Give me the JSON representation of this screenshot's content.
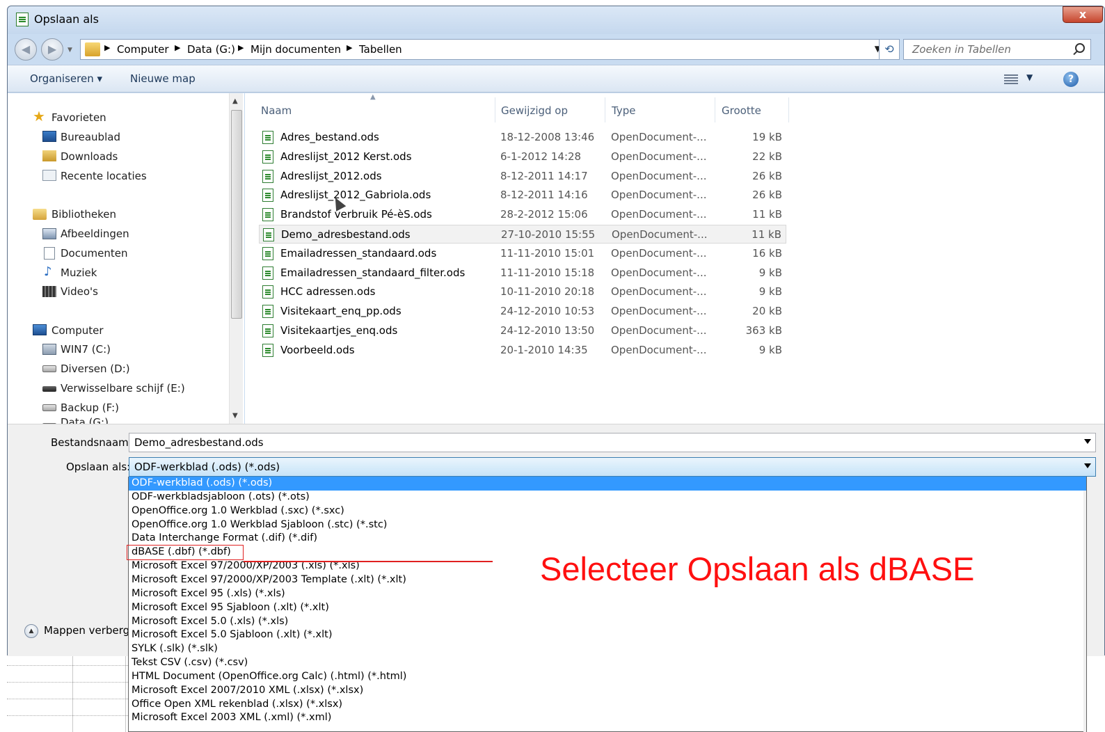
{
  "window": {
    "title": "Opslaan als",
    "close_label": "x"
  },
  "address": {
    "breadcrumbs": [
      "Computer",
      "Data (G:)",
      "Mijn documenten",
      "Tabellen"
    ],
    "search_placeholder": "Zoeken in Tabellen"
  },
  "toolbar": {
    "organize_label": "Organiseren ▾",
    "new_folder_label": "Nieuwe map"
  },
  "nav": {
    "favorites": "Favorieten",
    "desktop": "Bureaublad",
    "downloads": "Downloads",
    "recent": "Recente locaties",
    "libraries": "Bibliotheken",
    "pictures": "Afbeeldingen",
    "documents": "Documenten",
    "music": "Muziek",
    "videos": "Video's",
    "computer": "Computer",
    "drive_c": "WIN7 (C:)",
    "drive_d": "Diversen (D:)",
    "drive_e": "Verwisselbare schijf (E:)",
    "drive_f": "Backup (F:)",
    "drive_g": "Data (G:)"
  },
  "columns": {
    "name": "Naam",
    "modified": "Gewijzigd op",
    "type": "Type",
    "size": "Grootte"
  },
  "files": [
    {
      "name": "Adres_bestand.ods",
      "modified": "18-12-2008 13:46",
      "type": "OpenDocument-...",
      "size": "19 kB"
    },
    {
      "name": "Adreslijst_2012 Kerst.ods",
      "modified": "6-1-2012 14:28",
      "type": "OpenDocument-...",
      "size": "22 kB"
    },
    {
      "name": "Adreslijst_2012.ods",
      "modified": "8-12-2011 14:17",
      "type": "OpenDocument-...",
      "size": "26 kB"
    },
    {
      "name": "Adreslijst_2012_Gabriola.ods",
      "modified": "8-12-2011 14:16",
      "type": "OpenDocument-...",
      "size": "26 kB"
    },
    {
      "name": "Brandstof verbruik Pé-èS.ods",
      "modified": "28-2-2012 15:06",
      "type": "OpenDocument-...",
      "size": "11 kB"
    },
    {
      "name": "Demo_adresbestand.ods",
      "modified": "27-10-2010 15:55",
      "type": "OpenDocument-...",
      "size": "11 kB"
    },
    {
      "name": "Emailadressen_standaard.ods",
      "modified": "11-11-2010 15:01",
      "type": "OpenDocument-...",
      "size": "16 kB"
    },
    {
      "name": "Emailadressen_standaard_filter.ods",
      "modified": "11-11-2010 15:18",
      "type": "OpenDocument-...",
      "size": "9 kB"
    },
    {
      "name": "HCC adressen.ods",
      "modified": "10-11-2010 20:18",
      "type": "OpenDocument-...",
      "size": "9 kB"
    },
    {
      "name": "Visitekaart_enq_pp.ods",
      "modified": "24-12-2010 10:53",
      "type": "OpenDocument-...",
      "size": "20 kB"
    },
    {
      "name": "Visitekaartjes_enq.ods",
      "modified": "24-12-2010 13:50",
      "type": "OpenDocument-...",
      "size": "363 kB"
    },
    {
      "name": "Voorbeeld.ods",
      "modified": "20-1-2010 14:35",
      "type": "OpenDocument-...",
      "size": "9 kB"
    }
  ],
  "form": {
    "filename_label": "Bestandsnaam:",
    "filename_value": "Demo_adresbestand.ods",
    "savetype_label": "Opslaan als:",
    "savetype_value": "ODF-werkblad (.ods) (*.ods)",
    "hide_folders_label": "Mappen verberge"
  },
  "filetypes": [
    "ODF-werkblad (.ods) (*.ods)",
    "ODF-werkbladsjabloon (.ots) (*.ots)",
    "OpenOffice.org 1.0 Werkblad (.sxc) (*.sxc)",
    "OpenOffice.org 1.0 Werkblad Sjabloon (.stc) (*.stc)",
    "Data Interchange Format (.dif) (*.dif)",
    "dBASE (.dbf) (*.dbf)",
    "Microsoft Excel 97/2000/XP/2003 (.xls) (*.xls)",
    "Microsoft Excel 97/2000/XP/2003 Template (.xlt) (*.xlt)",
    "Microsoft Excel 95 (.xls) (*.xls)",
    "Microsoft Excel 95 Sjabloon (.xlt) (*.xlt)",
    "Microsoft Excel 5.0 (.xls) (*.xls)",
    "Microsoft Excel 5.0 Sjabloon (.xlt) (*.xlt)",
    "SYLK (.slk) (*.slk)",
    "Tekst CSV (.csv) (*.csv)",
    "HTML Document (OpenOffice.org Calc) (.html) (*.html)",
    "Microsoft Excel 2007/2010 XML (.xlsx) (*.xlsx)",
    "Office Open XML rekenblad (.xlsx) (*.xlsx)",
    "Microsoft Excel 2003 XML (.xml) (*.xml)"
  ],
  "annotation": {
    "text": "Selecteer Opslaan als dBASE",
    "color": "#ff1010"
  }
}
